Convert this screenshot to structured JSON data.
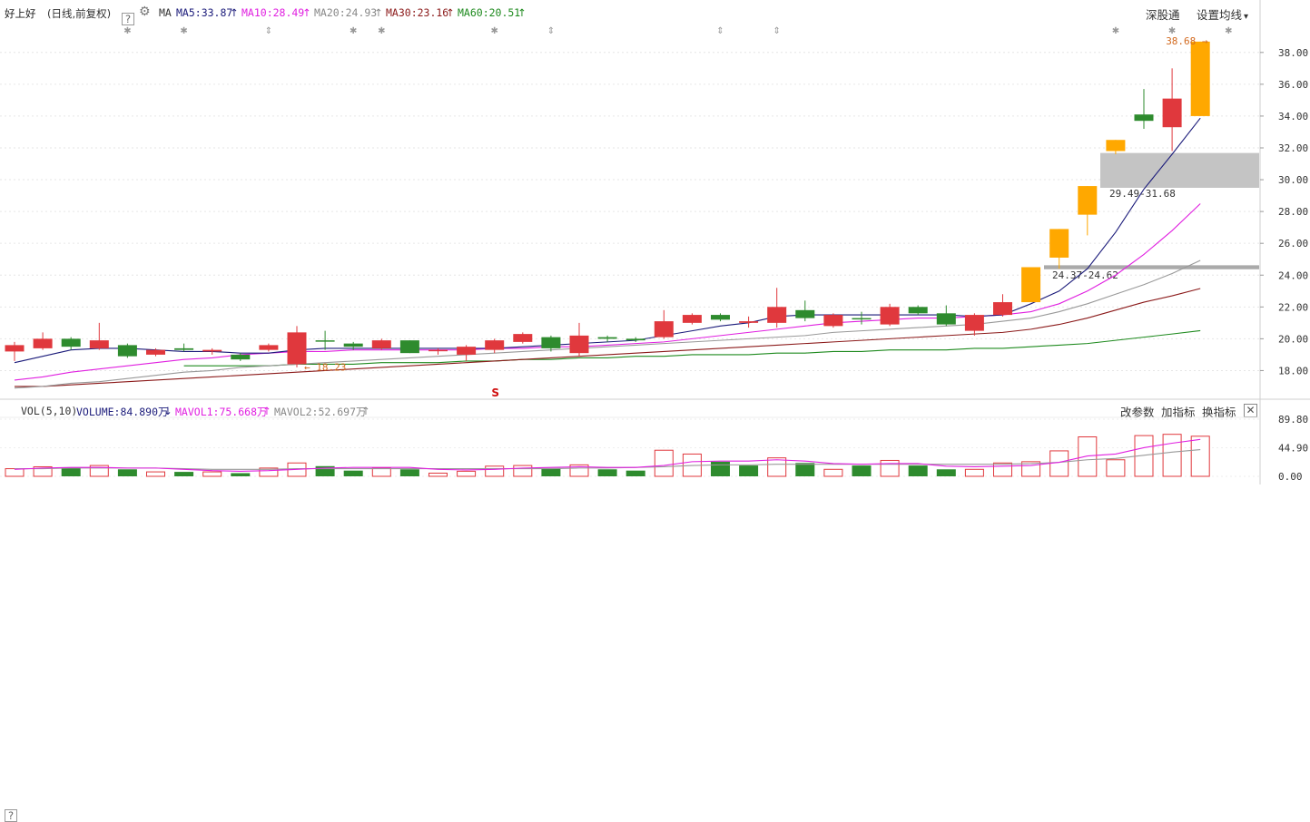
{
  "header": {
    "stock_name": "好上好",
    "mode": "(日线,前复权)",
    "help_icon": "?",
    "ma_label": "MA",
    "ma5": "MA5:33.87",
    "ma10": "MA10:28.49",
    "ma20": "MA20:24.93",
    "ma30": "MA30:23.16",
    "ma60": "MA60:20.51",
    "up_arrow": "↑",
    "shen_gu_tong": "深股通",
    "set_ma": "设置均线",
    "dropdown": "▾"
  },
  "volume_header": {
    "help_icon": "?",
    "vol_label": "VOL(5,10)",
    "volume": "VOLUME:84.890万",
    "down_arrow": "↓",
    "mavol1": "MAVOL1:75.668万",
    "mavol2": "MAVOL2:52.697万",
    "up_arrow": "↑",
    "change_param": "改参数",
    "add_indicator": "加指标",
    "swap_indicator": "换指标",
    "close": "✕"
  },
  "colors": {
    "up": "#e0383d",
    "down": "#2e8b2e",
    "limit_up": "#ffa800",
    "ma5": "#1b1b7a",
    "ma10": "#e020e0",
    "ma20": "#999999",
    "ma30": "#8b1a1a",
    "ma60": "#1e8a1e",
    "annotation": "#d2691e"
  },
  "chart_data": {
    "type": "candlestick",
    "price_axis": {
      "ticks": [
        "18.00",
        "20.00",
        "22.00",
        "24.00",
        "26.00",
        "28.00",
        "30.00",
        "32.00",
        "34.00",
        "36.00",
        "38.00"
      ],
      "range": [
        16.2,
        39.7
      ]
    },
    "volume_axis": {
      "ticks": [
        "0.00",
        "44.90",
        "89.80"
      ],
      "unit": "万"
    },
    "candles": [
      {
        "open": 19.2,
        "high": 19.8,
        "low": 18.6,
        "close": 19.6,
        "type": "up"
      },
      {
        "open": 19.4,
        "high": 20.4,
        "low": 19.3,
        "close": 20.0,
        "type": "up"
      },
      {
        "open": 20.0,
        "high": 20.1,
        "low": 19.3,
        "close": 19.5,
        "type": "down"
      },
      {
        "open": 19.4,
        "high": 21.0,
        "low": 19.3,
        "close": 19.9,
        "type": "up"
      },
      {
        "open": 19.6,
        "high": 19.7,
        "low": 18.8,
        "close": 18.9,
        "type": "down"
      },
      {
        "open": 19.0,
        "high": 19.4,
        "low": 18.9,
        "close": 19.3,
        "type": "up"
      },
      {
        "open": 19.4,
        "high": 19.7,
        "low": 19.2,
        "close": 19.3,
        "type": "down"
      },
      {
        "open": 19.2,
        "high": 19.4,
        "low": 19.0,
        "close": 19.3,
        "type": "up"
      },
      {
        "open": 19.0,
        "high": 19.1,
        "low": 18.6,
        "close": 18.7,
        "type": "down"
      },
      {
        "open": 19.3,
        "high": 19.7,
        "low": 19.2,
        "close": 19.6,
        "type": "up"
      },
      {
        "open": 18.4,
        "high": 20.8,
        "low": 18.2,
        "close": 20.4,
        "type": "up"
      },
      {
        "open": 19.9,
        "high": 20.5,
        "low": 19.3,
        "close": 19.9,
        "type": "down"
      },
      {
        "open": 19.7,
        "high": 19.8,
        "low": 19.3,
        "close": 19.5,
        "type": "down"
      },
      {
        "open": 19.4,
        "high": 20.0,
        "low": 19.3,
        "close": 19.9,
        "type": "up"
      },
      {
        "open": 19.9,
        "high": 19.9,
        "low": 19.1,
        "close": 19.1,
        "type": "down"
      },
      {
        "open": 19.3,
        "high": 19.4,
        "low": 19.0,
        "close": 19.3,
        "type": "up"
      },
      {
        "open": 19.0,
        "high": 19.6,
        "low": 18.6,
        "close": 19.5,
        "type": "up"
      },
      {
        "open": 19.3,
        "high": 20.0,
        "low": 19.1,
        "close": 19.9,
        "type": "up"
      },
      {
        "open": 19.8,
        "high": 20.4,
        "low": 19.7,
        "close": 20.3,
        "type": "up"
      },
      {
        "open": 20.1,
        "high": 20.2,
        "low": 19.2,
        "close": 19.4,
        "type": "down"
      },
      {
        "open": 19.1,
        "high": 21.0,
        "low": 18.9,
        "close": 20.2,
        "type": "up"
      },
      {
        "open": 20.1,
        "high": 20.2,
        "low": 19.8,
        "close": 20.0,
        "type": "down"
      },
      {
        "open": 19.9,
        "high": 20.1,
        "low": 19.8,
        "close": 20.0,
        "type": "down"
      },
      {
        "open": 20.1,
        "high": 21.8,
        "low": 20.0,
        "close": 21.1,
        "type": "up"
      },
      {
        "open": 21.0,
        "high": 21.6,
        "low": 20.9,
        "close": 21.5,
        "type": "up"
      },
      {
        "open": 21.5,
        "high": 21.6,
        "low": 21.1,
        "close": 21.2,
        "type": "down"
      },
      {
        "open": 21.0,
        "high": 21.4,
        "low": 20.7,
        "close": 21.1,
        "type": "up"
      },
      {
        "open": 21.0,
        "high": 23.2,
        "low": 20.7,
        "close": 22.0,
        "type": "up"
      },
      {
        "open": 21.8,
        "high": 22.4,
        "low": 21.1,
        "close": 21.3,
        "type": "down"
      },
      {
        "open": 20.8,
        "high": 21.6,
        "low": 20.7,
        "close": 21.5,
        "type": "up"
      },
      {
        "open": 21.3,
        "high": 21.7,
        "low": 20.9,
        "close": 21.3,
        "type": "down"
      },
      {
        "open": 20.9,
        "high": 22.2,
        "low": 20.8,
        "close": 22.0,
        "type": "up"
      },
      {
        "open": 22.0,
        "high": 22.1,
        "low": 21.5,
        "close": 21.6,
        "type": "down"
      },
      {
        "open": 21.6,
        "high": 22.1,
        "low": 20.8,
        "close": 20.9,
        "type": "down"
      },
      {
        "open": 20.5,
        "high": 21.6,
        "low": 20.2,
        "close": 21.5,
        "type": "up"
      },
      {
        "open": 21.5,
        "high": 22.8,
        "low": 21.4,
        "close": 22.3,
        "type": "up"
      },
      {
        "open": 22.3,
        "high": 24.4,
        "low": 22.3,
        "close": 24.5,
        "type": "limit"
      },
      {
        "open": 25.1,
        "high": 26.9,
        "low": 24.4,
        "close": 26.9,
        "type": "limit"
      },
      {
        "open": 27.8,
        "high": 29.6,
        "low": 26.5,
        "close": 29.6,
        "type": "limit"
      },
      {
        "open": 31.8,
        "high": 32.5,
        "low": 31.6,
        "close": 32.5,
        "type": "limit"
      },
      {
        "open": 34.1,
        "high": 35.7,
        "low": 33.2,
        "close": 33.7,
        "type": "down"
      },
      {
        "open": 33.3,
        "high": 37.0,
        "low": 31.8,
        "close": 35.1,
        "type": "up"
      },
      {
        "open": 34.0,
        "high": 38.68,
        "low": 34.0,
        "close": 38.68,
        "type": "limit"
      }
    ],
    "volumes": [
      {
        "v": 12,
        "type": "up"
      },
      {
        "v": 15,
        "type": "up"
      },
      {
        "v": 13,
        "type": "down"
      },
      {
        "v": 17,
        "type": "up"
      },
      {
        "v": 11,
        "type": "down"
      },
      {
        "v": 7,
        "type": "up"
      },
      {
        "v": 7,
        "type": "down"
      },
      {
        "v": 7,
        "type": "up"
      },
      {
        "v": 5,
        "type": "down"
      },
      {
        "v": 13,
        "type": "up"
      },
      {
        "v": 21,
        "type": "up"
      },
      {
        "v": 16,
        "type": "down"
      },
      {
        "v": 9,
        "type": "down"
      },
      {
        "v": 13,
        "type": "up"
      },
      {
        "v": 11,
        "type": "down"
      },
      {
        "v": 5,
        "type": "up"
      },
      {
        "v": 8,
        "type": "up"
      },
      {
        "v": 16,
        "type": "up"
      },
      {
        "v": 17,
        "type": "up"
      },
      {
        "v": 13,
        "type": "down"
      },
      {
        "v": 18,
        "type": "up"
      },
      {
        "v": 11,
        "type": "down"
      },
      {
        "v": 9,
        "type": "down"
      },
      {
        "v": 41,
        "type": "up"
      },
      {
        "v": 35,
        "type": "up"
      },
      {
        "v": 23,
        "type": "down"
      },
      {
        "v": 17,
        "type": "down"
      },
      {
        "v": 29,
        "type": "up"
      },
      {
        "v": 21,
        "type": "down"
      },
      {
        "v": 11,
        "type": "up"
      },
      {
        "v": 17,
        "type": "down"
      },
      {
        "v": 25,
        "type": "up"
      },
      {
        "v": 17,
        "type": "down"
      },
      {
        "v": 11,
        "type": "down"
      },
      {
        "v": 11,
        "type": "up"
      },
      {
        "v": 21,
        "type": "up"
      },
      {
        "v": 23,
        "type": "up"
      },
      {
        "v": 40,
        "type": "up"
      },
      {
        "v": 62,
        "type": "up"
      },
      {
        "v": 26,
        "type": "up"
      },
      {
        "v": 64,
        "type": "up"
      },
      {
        "v": 66,
        "type": "up"
      },
      {
        "v": 63,
        "type": "up"
      }
    ],
    "ma_lines": {
      "ma5": [
        18.5,
        18.9,
        19.3,
        19.4,
        19.4,
        19.3,
        19.2,
        19.2,
        19.1,
        19.1,
        19.3,
        19.4,
        19.4,
        19.4,
        19.4,
        19.4,
        19.4,
        19.4,
        19.5,
        19.6,
        19.7,
        19.8,
        19.9,
        20.2,
        20.5,
        20.8,
        21.0,
        21.4,
        21.5,
        21.5,
        21.5,
        21.5,
        21.5,
        21.5,
        21.4,
        21.5,
        22.2,
        23.0,
        24.4,
        26.7,
        29.4,
        31.6,
        33.87
      ],
      "ma10": [
        17.4,
        17.6,
        17.9,
        18.1,
        18.3,
        18.5,
        18.7,
        18.8,
        19.0,
        19.1,
        19.2,
        19.2,
        19.3,
        19.3,
        19.3,
        19.3,
        19.3,
        19.4,
        19.4,
        19.5,
        19.5,
        19.6,
        19.7,
        19.8,
        20.0,
        20.2,
        20.4,
        20.6,
        20.8,
        21.0,
        21.1,
        21.2,
        21.3,
        21.3,
        21.4,
        21.5,
        21.7,
        22.2,
        23.0,
        24.0,
        25.3,
        26.8,
        28.49
      ],
      "ma20": [
        16.9,
        17.0,
        17.2,
        17.3,
        17.5,
        17.7,
        17.9,
        18.0,
        18.2,
        18.3,
        18.4,
        18.5,
        18.6,
        18.7,
        18.8,
        18.9,
        19.0,
        19.1,
        19.2,
        19.3,
        19.4,
        19.5,
        19.6,
        19.7,
        19.8,
        19.9,
        20.0,
        20.1,
        20.2,
        20.4,
        20.5,
        20.6,
        20.7,
        20.8,
        20.9,
        21.1,
        21.3,
        21.7,
        22.2,
        22.8,
        23.4,
        24.1,
        24.93
      ],
      "ma30": [
        17.0,
        17.0,
        17.1,
        17.2,
        17.3,
        17.4,
        17.5,
        17.6,
        17.7,
        17.8,
        17.9,
        18.0,
        18.1,
        18.2,
        18.3,
        18.4,
        18.5,
        18.6,
        18.7,
        18.8,
        18.9,
        19.0,
        19.1,
        19.2,
        19.3,
        19.4,
        19.5,
        19.6,
        19.7,
        19.8,
        19.9,
        20.0,
        20.1,
        20.2,
        20.3,
        20.4,
        20.6,
        20.9,
        21.3,
        21.8,
        22.3,
        22.7,
        23.16
      ],
      "ma60_start": 6,
      "ma60": [
        18.3,
        18.3,
        18.3,
        18.3,
        18.4,
        18.4,
        18.4,
        18.5,
        18.5,
        18.5,
        18.6,
        18.6,
        18.7,
        18.7,
        18.8,
        18.8,
        18.9,
        18.9,
        19.0,
        19.0,
        19.0,
        19.1,
        19.1,
        19.2,
        19.2,
        19.3,
        19.3,
        19.3,
        19.4,
        19.4,
        19.5,
        19.6,
        19.7,
        19.9,
        20.1,
        20.3,
        20.51
      ]
    },
    "mavol1": [
      11,
      13,
      14,
      14,
      13,
      13,
      11,
      9,
      8,
      9,
      11,
      13,
      14,
      14,
      14,
      11,
      10,
      11,
      13,
      14,
      15,
      14,
      14,
      17,
      23,
      24,
      24,
      26,
      24,
      20,
      19,
      20,
      20,
      16,
      15,
      16,
      17,
      22,
      32,
      35,
      45,
      52,
      58
    ],
    "mavol2": [
      12,
      12,
      13,
      13,
      13,
      13,
      12,
      11,
      11,
      11,
      12,
      12,
      12,
      12,
      12,
      12,
      12,
      12,
      12,
      12,
      13,
      13,
      14,
      15,
      17,
      18,
      18,
      19,
      19,
      19,
      19,
      19,
      19,
      19,
      19,
      19,
      20,
      22,
      26,
      28,
      33,
      38,
      42
    ],
    "annotations": {
      "high_label": "38.68",
      "low_label": "18.23",
      "zone_upper": "29.49-31.68",
      "zone_lower": "24.37-24.62",
      "s_marker": "S"
    },
    "event_markers": [
      "✱",
      "✱",
      "⇕",
      "✱",
      "✱",
      "✱",
      "⇕",
      "⇕",
      "⇕",
      "✱",
      "✱",
      "✱"
    ]
  }
}
